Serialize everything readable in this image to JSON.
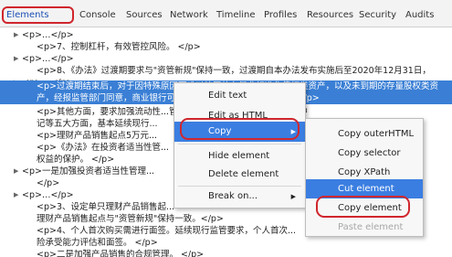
{
  "tabs": [
    "Elements",
    "Console",
    "Sources",
    "Network",
    "Timeline",
    "Profiles",
    "Resources",
    "Security",
    "Audits"
  ],
  "code_lines": [
    "<p>…</p>",
    "<p>7、控制杠杆，有效管控风险。 </p>",
    "<p>…</p>",
    "<p>8、《办法》过渡期要求与\"资管新规\"保持一致，过渡期自本办法发布实施后至2020年12月31日，",
    "<p>…</p>",
    "<p>过渡期结束后，对于因特殊原因而难以处置的存量非标准化债权类资产，以及未到期的存量股权类资",
    "产，经报监管部门同意，商业银行可以通过...管理，逐步消化处理。</p>",
    "<p>其他方面，要求加强流动性...管理，加强信息披露，实行产品集中",
    "记等五大方面，基本延续现行...",
    "<p>理财产品销售起点5万元...",
    "<p>《办法》在投资者适当性管...",
    "权益的保护。 </p>",
    "<p>一是加强投资者适当性管理...",
    "</p>",
    "<p>…</p>",
    "<p>3、设定单只理财产品销售起...",
    "理财产品销售起点与\"资管新规\"保持一致。</p>",
    "<p>4、个人首次购买需进行面签。延续现行监管要求，个人首次...",
    "险承受能力评估和面签。 </p>",
    "<p>二是加强产品销售的合规管理。 </p>"
  ],
  "context_menu": {
    "items": [
      "Edit text",
      "Edit as HTML",
      "Copy",
      "Hide element",
      "Delete element",
      "Break on..."
    ]
  },
  "copy_submenu": {
    "items": [
      "Copy outerHTML",
      "Copy selector",
      "Copy XPath",
      "Cut element",
      "Copy element",
      "Paste element"
    ]
  },
  "colors": {
    "selection": "#3a7fd5",
    "menu_highlight": "#3b7ee1",
    "annotation_red": "#d0262d"
  }
}
